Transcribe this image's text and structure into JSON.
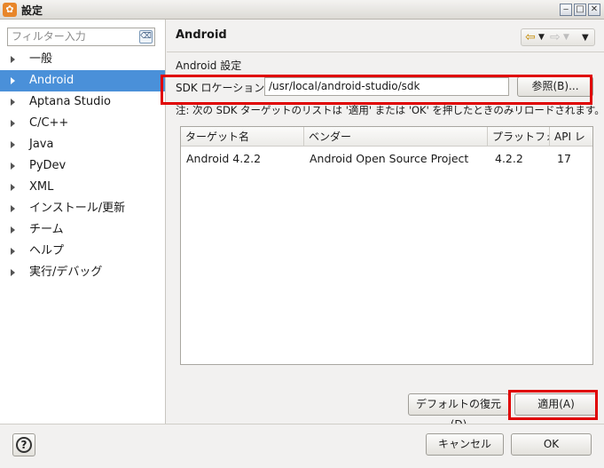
{
  "window": {
    "title": "設定",
    "app_icon": "gear-icon",
    "controls": [
      "minimize",
      "maximize",
      "close"
    ]
  },
  "sidebar": {
    "filter_placeholder": "フィルター入力",
    "items": [
      {
        "label": "一般",
        "selected": false
      },
      {
        "label": "Android",
        "selected": true
      },
      {
        "label": "Aptana Studio",
        "selected": false
      },
      {
        "label": "C/C++",
        "selected": false
      },
      {
        "label": "Java",
        "selected": false
      },
      {
        "label": "PyDev",
        "selected": false
      },
      {
        "label": "XML",
        "selected": false
      },
      {
        "label": "インストール/更新",
        "selected": false
      },
      {
        "label": "チーム",
        "selected": false
      },
      {
        "label": "ヘルプ",
        "selected": false
      },
      {
        "label": "実行/デバッグ",
        "selected": false
      }
    ]
  },
  "page": {
    "title": "Android",
    "section_label": "Android 設定",
    "sdk_label": "SDK ロケーション:",
    "sdk_value": "/usr/local/android-studio/sdk",
    "browse_label": "参照(B)...",
    "note": "注: 次の SDK ターゲットのリストは '適用' または 'OK' を押したときのみリロードされます。",
    "table": {
      "columns": [
        "ターゲット名",
        "ベンダー",
        "プラットフォ",
        "API レ"
      ],
      "rows": [
        [
          "Android 4.2.2",
          "Android Open Source Project",
          "4.2.2",
          "17"
        ]
      ]
    },
    "restore_label": "デフォルトの復元(D)",
    "apply_label": "適用(A)"
  },
  "footer": {
    "cancel_label": "キャンセル",
    "ok_label": "OK"
  },
  "colors": {
    "selection": "#4a90d9",
    "highlight_box": "#e00000"
  }
}
